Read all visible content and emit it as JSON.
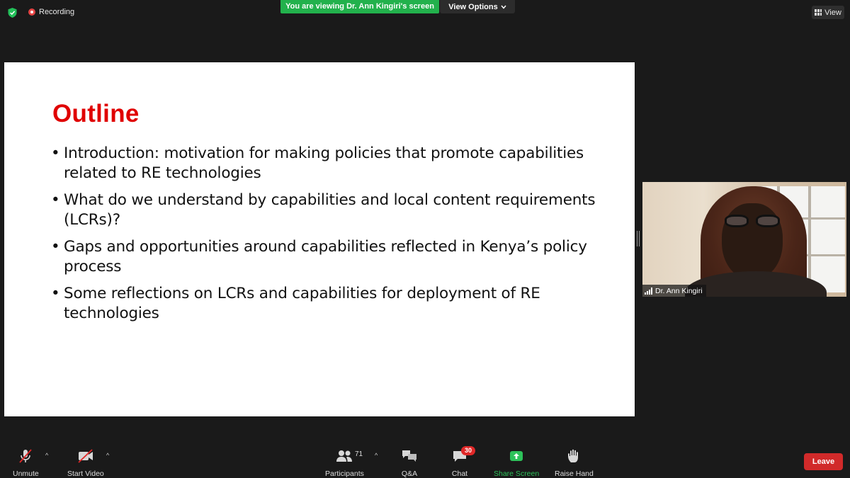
{
  "top_bar": {
    "recording_label": "Recording",
    "viewing_banner": "You are viewing Dr. Ann Kingiri's screen",
    "view_options_label": "View Options",
    "view_label": "View"
  },
  "slide": {
    "title": "Outline",
    "bullets": [
      "Introduction: motivation for making policies that promote capabilities related to RE technologies",
      "What do we understand by capabilities and local content requirements (LCRs)?",
      "Gaps and opportunities around capabilities reflected in Kenya’s policy process",
      "Some reflections on LCRs and capabilities for deployment of RE technologies"
    ]
  },
  "video": {
    "participant_name": "Dr. Ann Kingiri"
  },
  "toolbar": {
    "unmute_label": "Unmute",
    "start_video_label": "Start Video",
    "participants_label": "Participants",
    "participants_count": "71",
    "qa_label": "Q&A",
    "chat_label": "Chat",
    "chat_badge": "30",
    "share_screen_label": "Share Screen",
    "raise_hand_label": "Raise Hand",
    "leave_label": "Leave"
  },
  "colors": {
    "share_green": "#2dc25a",
    "banner_green": "#22b14c",
    "leave_red": "#d12a2a",
    "title_red": "#e00000"
  }
}
